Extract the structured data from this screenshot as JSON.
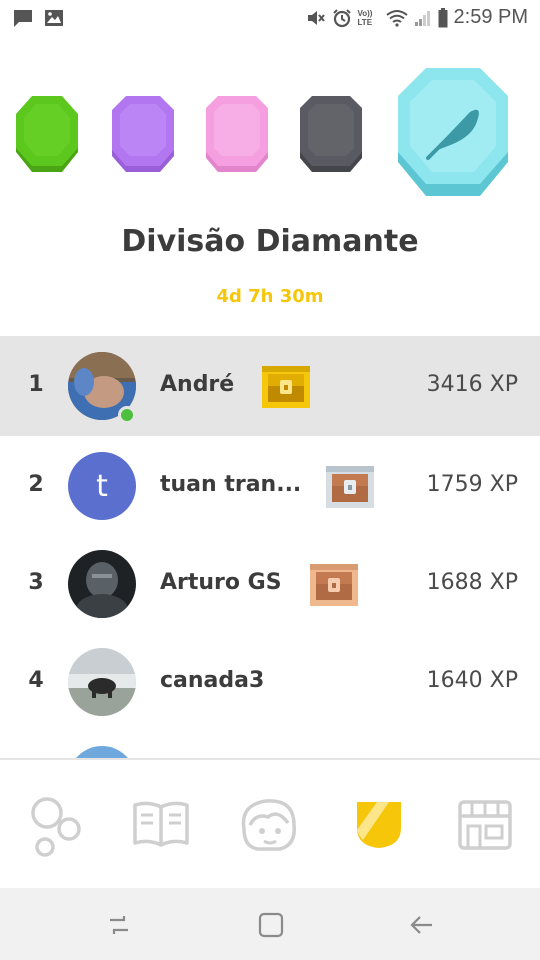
{
  "status_bar": {
    "time": "2:59 PM",
    "volte_label": "Vo)) LTE"
  },
  "league": {
    "title": "Divisão Diamante",
    "countdown": "4d 7h 30m",
    "badges": [
      {
        "name": "green",
        "color": "#5cc81e"
      },
      {
        "name": "purple",
        "color": "#b277f0"
      },
      {
        "name": "pink",
        "color": "#f59ee0"
      },
      {
        "name": "dark",
        "color": "#5a5a62"
      },
      {
        "name": "diamond",
        "color": "#8de6ee",
        "current": true
      }
    ]
  },
  "leaderboard": [
    {
      "rank": "1",
      "name": "André",
      "xp": "3416 XP",
      "chest": "gold",
      "online": true,
      "avatar": "photo-blue"
    },
    {
      "rank": "2",
      "name": "tuan tran...",
      "xp": "1759 XP",
      "chest": "silver",
      "online": false,
      "avatar": "letter",
      "avatar_letter": "t"
    },
    {
      "rank": "3",
      "name": "Arturo GS",
      "xp": "1688 XP",
      "chest": "bronze",
      "online": false,
      "avatar": "photo-dark"
    },
    {
      "rank": "4",
      "name": "canada3",
      "xp": "1640 XP",
      "chest": "",
      "online": false,
      "avatar": "photo-bear"
    }
  ],
  "tabs": [
    {
      "name": "learn",
      "icon": "bubbles-icon",
      "active": false
    },
    {
      "name": "stories",
      "icon": "book-icon",
      "active": false
    },
    {
      "name": "profile",
      "icon": "face-icon",
      "active": false
    },
    {
      "name": "leagues",
      "icon": "shield-icon",
      "active": true
    },
    {
      "name": "shop",
      "icon": "shop-icon",
      "active": false
    }
  ],
  "colors": {
    "accent_gold": "#f5c60a",
    "highlight_row": "#e5e5e5",
    "online": "#4cbf3c",
    "text": "#3c3c3c"
  }
}
